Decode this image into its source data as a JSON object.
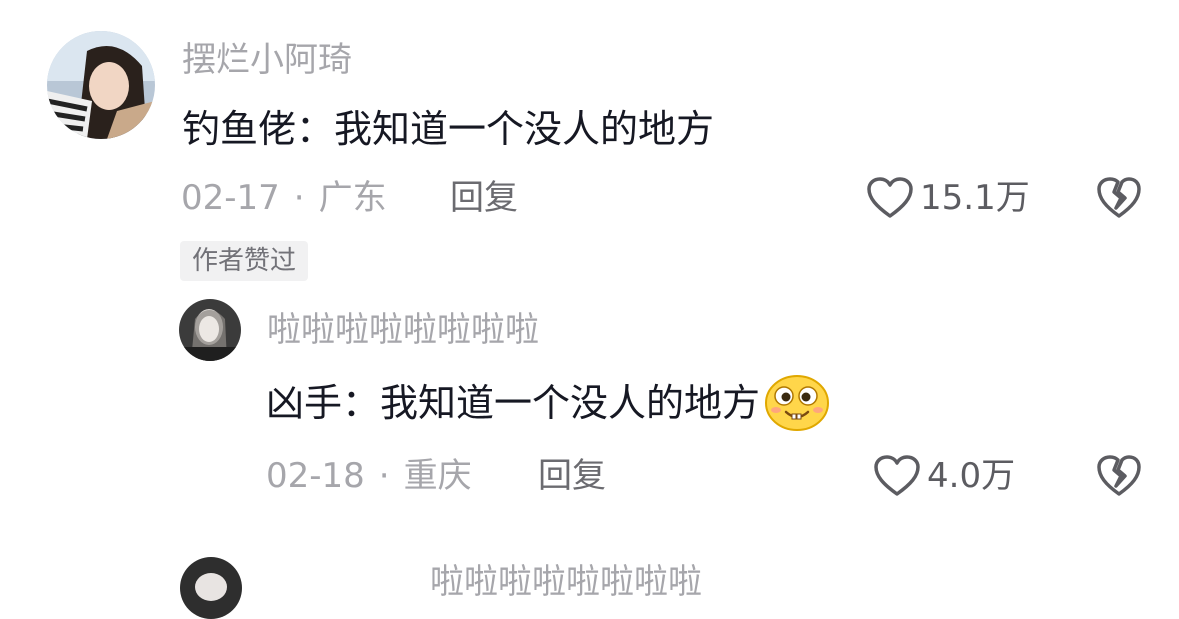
{
  "comments": [
    {
      "username": "摆烂小阿琦",
      "text": "钓鱼佬：我知道一个没人的地方",
      "date": "02-17",
      "separator": "·",
      "location": "广东",
      "reply_label": "回复",
      "like_count": "15.1万",
      "author_badge": "作者赞过"
    },
    {
      "username": "啦啦啦啦啦啦啦啦",
      "text": "凶手：我知道一个没人的地方",
      "emoji": "grinning-emoji",
      "date": "02-18",
      "separator": "·",
      "location": "重庆",
      "reply_label": "回复",
      "like_count": "4.0万"
    }
  ],
  "next_comment": {
    "username": "啦啦啦啦啦啦啦啦"
  },
  "colors": {
    "text_primary": "#161823",
    "text_secondary": "#a6a6ab",
    "icon_gray": "#5c5c61",
    "badge_bg": "#f1f1f2"
  },
  "icons": [
    "heart-icon",
    "broken-heart-icon"
  ]
}
